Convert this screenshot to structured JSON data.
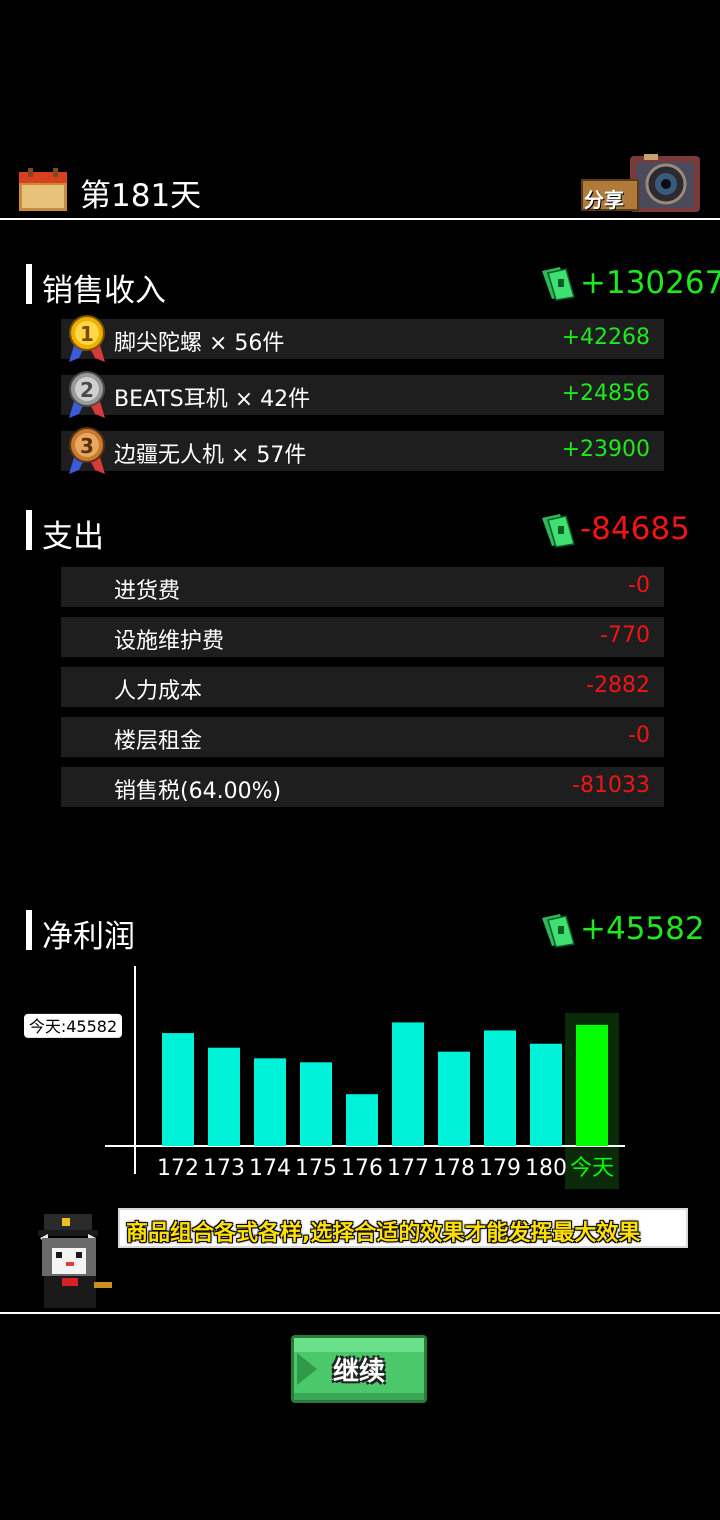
{
  "header": {
    "day_title": "第181天",
    "share_label": "分享"
  },
  "sales": {
    "title": "销售收入",
    "total": "+130267",
    "items": [
      {
        "rank": "1",
        "label": "脚尖陀螺 × 56件",
        "value": "+42268"
      },
      {
        "rank": "2",
        "label": "BEATS耳机 × 42件",
        "value": "+24856"
      },
      {
        "rank": "3",
        "label": "边疆无人机 × 57件",
        "value": "+23900"
      }
    ]
  },
  "expense": {
    "title": "支出",
    "total": "-84685",
    "items": [
      {
        "label": "进货费",
        "value": "-0"
      },
      {
        "label": "设施维护费",
        "value": "-770"
      },
      {
        "label": "人力成本",
        "value": "-2882"
      },
      {
        "label": "楼层租金",
        "value": "-0"
      },
      {
        "label": "销售税(64.00%)",
        "value": "-81033"
      }
    ]
  },
  "profit": {
    "title": "净利润",
    "total": "+45582"
  },
  "chart_data": {
    "type": "bar",
    "categories": [
      "172",
      "173",
      "174",
      "175",
      "176",
      "177",
      "178",
      "179",
      "180",
      "今天"
    ],
    "values": [
      42500,
      37000,
      33000,
      31500,
      19500,
      46500,
      35500,
      43500,
      38500,
      45582
    ],
    "marker_label": "今天:45582",
    "highlight_index": 9,
    "colors": {
      "bar": "#00f2d8",
      "highlight": "#00ff00",
      "highlight_bg": "#0a2a0a"
    },
    "ylim": [
      0,
      70000
    ]
  },
  "tip": {
    "text": "商品组合各式各样,选择合适的效果才能发挥最大效果"
  },
  "footer": {
    "continue_label": "继续"
  },
  "colors": {
    "positive": "#1ee81e",
    "negative": "#f01414",
    "row_bg": "#1e1e1e"
  }
}
